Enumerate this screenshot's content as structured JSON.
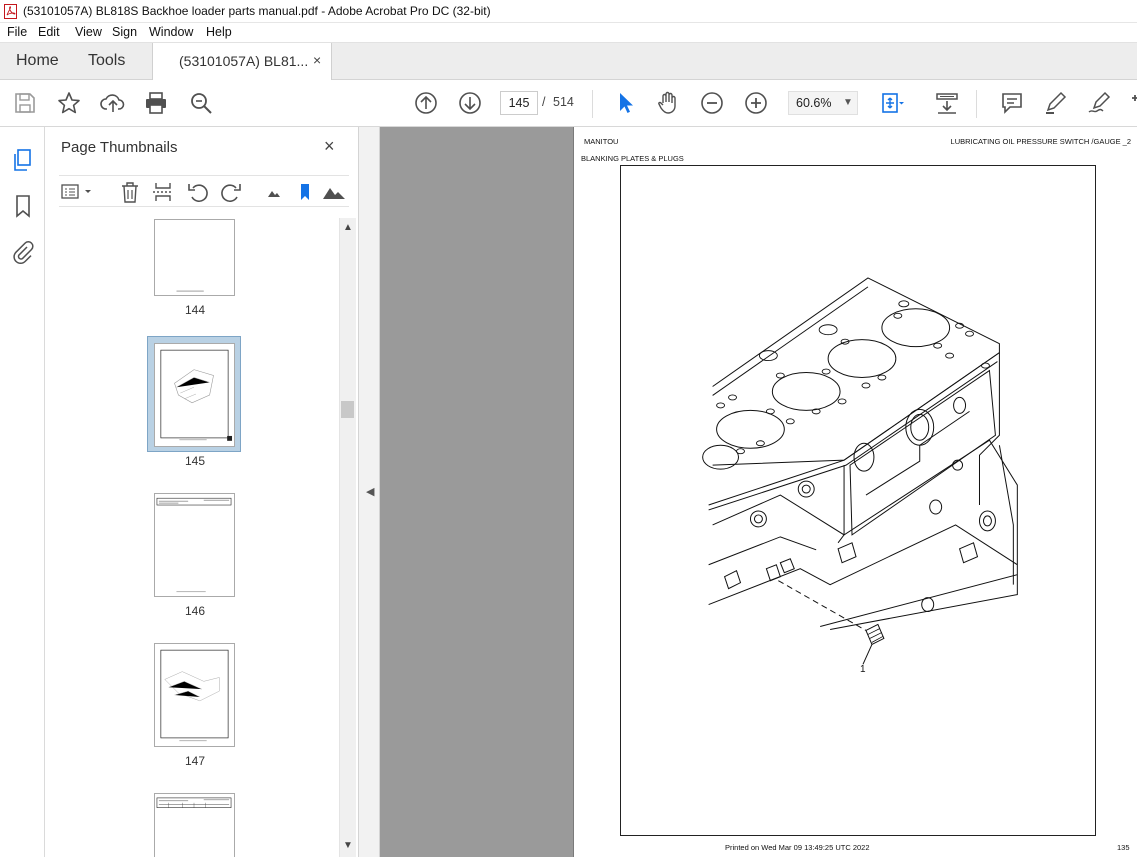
{
  "window": {
    "title": "(53101057A) BL818S Backhoe loader parts manual.pdf - Adobe Acrobat Pro DC (32-bit)"
  },
  "menu": [
    "File",
    "Edit",
    "View",
    "Sign",
    "Window",
    "Help"
  ],
  "tabs": {
    "home": "Home",
    "tools": "Tools",
    "document": "(53101057A) BL81...",
    "close": "×"
  },
  "toolbar": {
    "current_page": "145",
    "separator": "/",
    "page_count": "514",
    "zoom": "60.6%",
    "icons": [
      "save-icon",
      "star-icon",
      "upload-icon",
      "print-icon",
      "search-zoom-icon",
      "page-up-icon",
      "page-down-icon",
      "select-pointer-icon",
      "hand-icon",
      "zoom-out-icon",
      "zoom-in-icon",
      "fit-page-icon",
      "scroll-mode-icon",
      "comment-icon",
      "highlight-pen-icon",
      "sign-pen-icon"
    ]
  },
  "sidebar": {
    "title": "Page Thumbnails",
    "close": "×",
    "thumbnails": [
      {
        "page": "144"
      },
      {
        "page": "145",
        "selected": true
      },
      {
        "page": "146"
      },
      {
        "page": "147"
      }
    ]
  },
  "document": {
    "header_left": "MANITOU",
    "header_right": "LUBRICATING OIL PRESSURE SWITCH /GAUGE _2",
    "subheader": "BLANKING PLATES & PLUGS",
    "callout": "1",
    "footer": "Printed on  Wed Mar 09 13:49:25 UTC 2022",
    "page_number": "135"
  },
  "colors": {
    "accent_blue": "#1473e6",
    "doc_bg": "#9a9a9a",
    "thumb_selected": "#b9d1e4",
    "icon_grey": "#505050"
  }
}
